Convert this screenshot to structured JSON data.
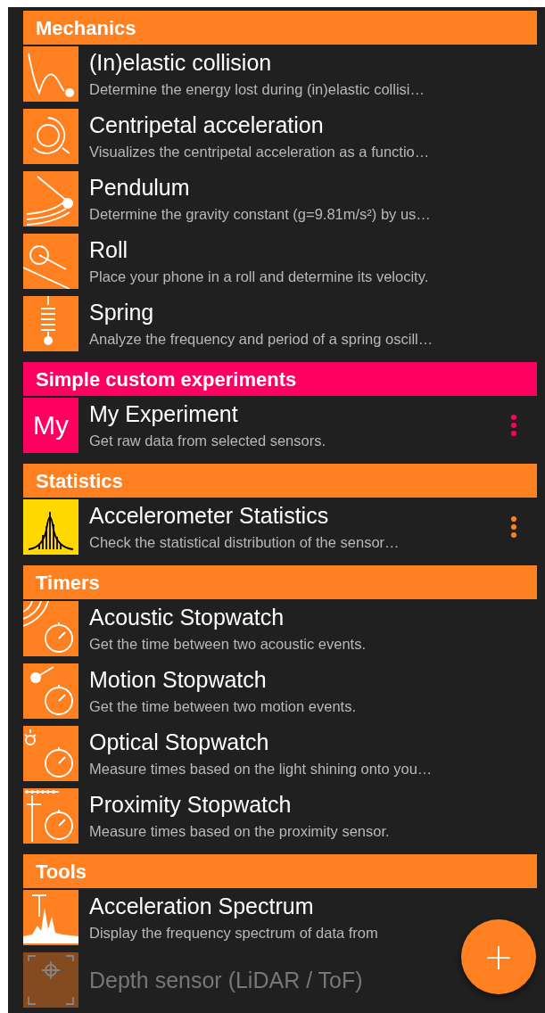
{
  "sections": [
    {
      "title": "Mechanics",
      "color": "#ff8020",
      "items": [
        {
          "kind": "collision",
          "title": "(In)elastic collision",
          "description": "Determine the energy lost during (in)elastic collisi…",
          "has_menu": false,
          "disabled": false
        },
        {
          "kind": "centripetal",
          "title": "Centripetal acceleration",
          "description": "Visualizes the centripetal acceleration as a functio…",
          "has_menu": false,
          "disabled": false
        },
        {
          "kind": "pendulum",
          "title": "Pendulum",
          "description": "Determine the gravity constant (g=9.81m/s²) by us…",
          "has_menu": false,
          "disabled": false
        },
        {
          "kind": "roll",
          "title": "Roll",
          "description": "Place your phone in a roll and determine its velocity.",
          "has_menu": false,
          "disabled": false
        },
        {
          "kind": "spring",
          "title": "Spring",
          "description": "Analyze the frequency and period of a spring oscill…",
          "has_menu": false,
          "disabled": false
        }
      ]
    },
    {
      "title": "Simple custom experiments",
      "color": "#ff0060",
      "items": [
        {
          "kind": "custom",
          "icon_text": "My",
          "title": "My Experiment",
          "description": "Get raw data from selected sensors.",
          "has_menu": true,
          "disabled": false
        }
      ]
    },
    {
      "title": "Statistics",
      "color": "#ff8020",
      "items": [
        {
          "kind": "statistics",
          "title": "Accelerometer Statistics",
          "description": "Check the statistical distribution of the sensor…",
          "has_menu": true,
          "disabled": false
        }
      ]
    },
    {
      "title": "Timers",
      "color": "#ff8020",
      "items": [
        {
          "kind": "acoustic",
          "title": "Acoustic Stopwatch",
          "description": "Get the time between two acoustic events.",
          "has_menu": false,
          "disabled": false
        },
        {
          "kind": "motion",
          "title": "Motion Stopwatch",
          "description": "Get the time between two motion events.",
          "has_menu": false,
          "disabled": false
        },
        {
          "kind": "optical",
          "title": "Optical Stopwatch",
          "description": "Measure times based on the light shining onto you…",
          "has_menu": false,
          "disabled": false
        },
        {
          "kind": "proximity",
          "title": "Proximity Stopwatch",
          "description": "Measure times based on the proximity sensor.",
          "has_menu": false,
          "disabled": false
        }
      ]
    },
    {
      "title": "Tools",
      "color": "#ff8020",
      "items": [
        {
          "kind": "spectrum",
          "title": "Acceleration Spectrum",
          "description": "Display the frequency spectrum of data from",
          "has_menu": false,
          "disabled": false
        },
        {
          "kind": "depth",
          "title": "Depth sensor (LiDAR / ToF)",
          "has_menu": false,
          "disabled": true
        }
      ]
    }
  ],
  "fab": {
    "label": "+"
  }
}
